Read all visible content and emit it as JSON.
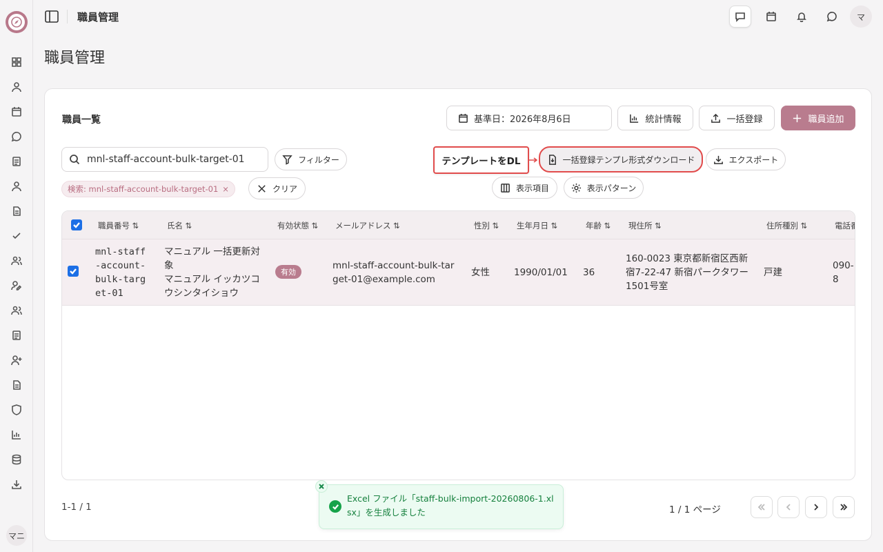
{
  "header": {
    "title": "職員管理",
    "avatar": "マ"
  },
  "sidebar": {
    "user": "マニ"
  },
  "page": {
    "title": "職員管理"
  },
  "card": {
    "title": "職員一覧",
    "date_button": "基準日：2026年8月6日",
    "stats_button": "統計情報",
    "bulk_button": "一括登録",
    "add_button": "職員追加"
  },
  "toolbar": {
    "search_value": "mnl-staff-account-bulk-target-01",
    "filter_button": "フィルター",
    "template_download_button": "一括登録テンプレ形式ダウンロード",
    "export_button": "エクスポート",
    "columns_button": "表示項目",
    "pattern_button": "表示パターン",
    "chip": "検索: mnl-staff-account-bulk-target-01",
    "clear_button": "クリア"
  },
  "callout": {
    "text": "テンプレートをDL"
  },
  "table": {
    "headers": [
      "職員番号 ⇅",
      "氏名 ⇅",
      "有効状態 ⇅",
      "メールアドレス ⇅",
      "性別 ⇅",
      "生年月日 ⇅",
      "年齢 ⇅",
      "現住所 ⇅",
      "住所種別 ⇅",
      "電話番"
    ],
    "row": {
      "id_lines": [
        "mnl-staff",
        "-account-",
        "bulk-targ",
        "et-01"
      ],
      "name_lines": [
        "マニュアル 一括更新対",
        "象",
        "マニュアル イッカツコ",
        "ウシンタイショウ"
      ],
      "status": "有効",
      "email_lines": [
        "mnl-staff-account-bulk-tar",
        "get-01@example.com"
      ],
      "gender": "女性",
      "birthdate": "1990/01/01",
      "age": "36",
      "address_lines": [
        "160-0023 東京都新宿区西新",
        "宿7-22-47 新宿パークタワー",
        "1501号室"
      ],
      "address_type": "戸建",
      "phone_lines": [
        "090-",
        "8"
      ]
    }
  },
  "footer": {
    "count": "1-1 / 1",
    "page_info": "1 / 1 ページ"
  },
  "toast": {
    "message": "Excel ファイル「staff-bulk-import-20260806-1.xlsx」を生成しました"
  },
  "colors": {
    "accent": "#b97c8e",
    "highlight": "#e14b4b",
    "success": "#16a34a"
  }
}
